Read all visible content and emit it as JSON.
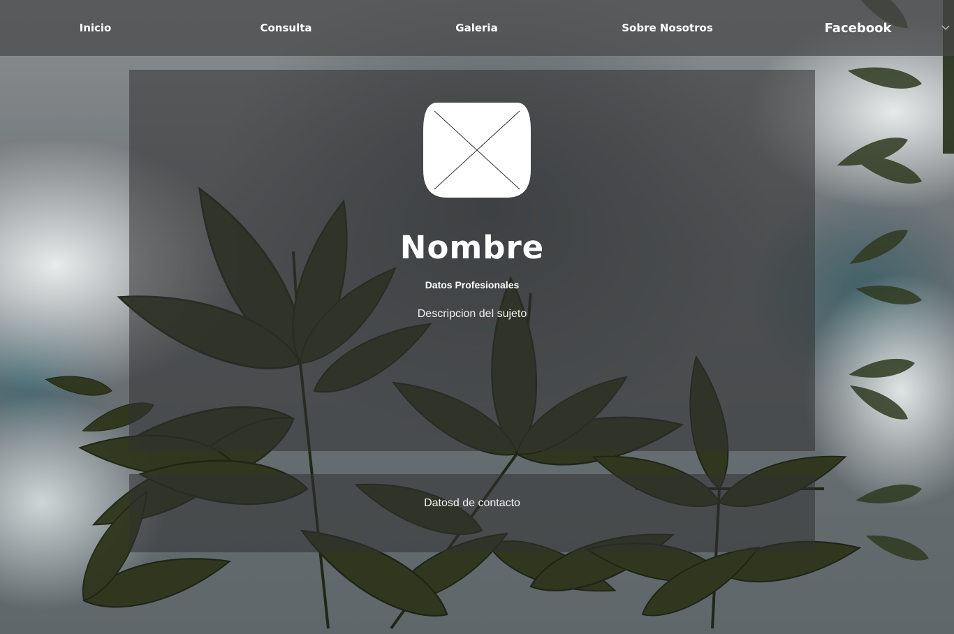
{
  "nav": {
    "items": [
      {
        "label": "Inicio"
      },
      {
        "label": "Consulta"
      },
      {
        "label": "Galeria"
      },
      {
        "label": "Sobre Nosotros"
      },
      {
        "label": "Facebook"
      }
    ]
  },
  "profile": {
    "name": "Nombre",
    "subtitle": "Datos Profesionales",
    "description": "Descripcion del sujeto"
  },
  "contact": {
    "text": "Datosd de contacto"
  },
  "colors": {
    "text": "#ffffff",
    "leaf_dark": "#1f2414",
    "leaf_mid": "#3a4220",
    "leaf_light": "#56602c"
  },
  "icons": {
    "avatar": "image-placeholder-icon",
    "dropdown": "chevron-down-icon"
  }
}
